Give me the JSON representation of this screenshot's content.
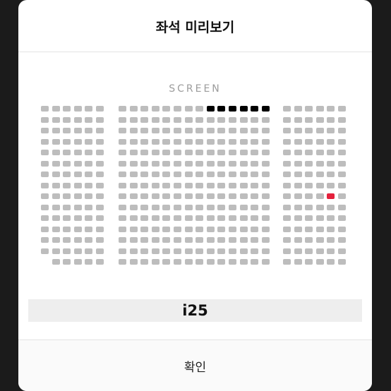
{
  "modal": {
    "title": "좌석 미리보기",
    "screen_label": "SCREEN",
    "selected_seat": "i25",
    "confirm_label": "확인"
  },
  "colors": {
    "available": "#bdbdbd",
    "booked": "#000000",
    "selected": "#e4213c"
  },
  "seat_map": {
    "row_count": 15,
    "blocks": [
      {
        "name": "left",
        "seats_per_row": 6,
        "rows_with_seats": [
          [
            1,
            2,
            3,
            4,
            5,
            6
          ],
          [
            1,
            2,
            3,
            4,
            5,
            6
          ],
          [
            1,
            2,
            3,
            4,
            5,
            6
          ],
          [
            1,
            2,
            3,
            4,
            5,
            6
          ],
          [
            1,
            2,
            3,
            4,
            5,
            6
          ],
          [
            1,
            2,
            3,
            4,
            5,
            6
          ],
          [
            1,
            2,
            3,
            4,
            5,
            6
          ],
          [
            1,
            2,
            3,
            4,
            5,
            6
          ],
          [
            1,
            2,
            3,
            4,
            5,
            6
          ],
          [
            1,
            2,
            3,
            4,
            5,
            6
          ],
          [
            1,
            2,
            3,
            4,
            5,
            6
          ],
          [
            1,
            2,
            3,
            4,
            5,
            6
          ],
          [
            1,
            2,
            3,
            4,
            5,
            6
          ],
          [
            1,
            2,
            3,
            4,
            5,
            6
          ],
          [
            2,
            3,
            4,
            5,
            6
          ]
        ],
        "booked": [],
        "selected": []
      },
      {
        "name": "center",
        "seats_per_row": 14,
        "rows_with_seats": "all",
        "booked": [
          [
            1,
            9
          ],
          [
            1,
            10
          ],
          [
            1,
            11
          ],
          [
            1,
            12
          ],
          [
            1,
            13
          ],
          [
            1,
            14
          ]
        ],
        "selected": []
      },
      {
        "name": "right",
        "seats_per_row": 6,
        "rows_with_seats": "all",
        "booked": [],
        "selected": [
          [
            9,
            5
          ]
        ]
      }
    ]
  }
}
